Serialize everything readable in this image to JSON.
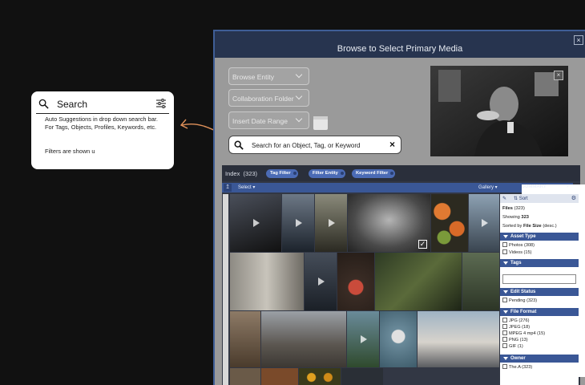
{
  "annotation": {
    "search_label": "Search",
    "description": "Auto Suggestions in drop down search bar.   For Tags, Objects, Profiles, Keywords, etc.",
    "filters_note": "Filters are shown u"
  },
  "dialog": {
    "title": "Browse to Select Primary Media",
    "close": "×",
    "fields": [
      "Browse Entity",
      "Collaboration Folder",
      "Insert Date Range"
    ],
    "search_placeholder": "Search for an Object, Tag, or Keyword",
    "search_clear": "×",
    "preview_close": "×"
  },
  "index": {
    "label": "Index",
    "count": "(323)",
    "chips": [
      "Tag Filter",
      "Filter Entity",
      "Keyword Filter"
    ],
    "toolbar": {
      "upload": "↥",
      "select": "Select ▾",
      "gallery": "Gallery ▾",
      "summary": "SUMMARY",
      "next": "›"
    }
  },
  "summary": {
    "sort": "⇅ Sort",
    "files_label": "Files",
    "files_count": "(323)",
    "showing_label": "Showing",
    "showing_count": "323",
    "sorted_prefix": "Sorted by",
    "sorted_field": "File Size",
    "sorted_dir": "(desc.)",
    "sections": {
      "asset_type": {
        "title": "Asset Type",
        "options": [
          "Photos (308)",
          "Videos (15)"
        ]
      },
      "tags": {
        "title": "Tags"
      },
      "edit_status": {
        "title": "Edit Status",
        "options": [
          "Pending (323)"
        ]
      },
      "file_format": {
        "title": "File Format",
        "options": [
          "JPG (276)",
          "JPEG (18)",
          "MPEG 4 mp4 (15)",
          "PNG (13)",
          "GIF (1)"
        ]
      },
      "owner": {
        "title": "Owner",
        "options": [
          "The.A (323)"
        ]
      }
    }
  },
  "colors": {
    "panel": "#323744",
    "header": "#27344f",
    "accent": "#3a5796",
    "chip": "#4b6bb5",
    "annotation_arrow": "#e0915a"
  }
}
